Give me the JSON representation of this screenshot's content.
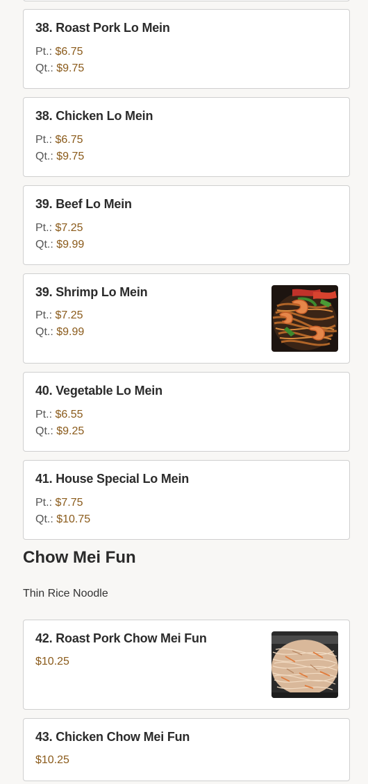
{
  "items": [
    {
      "name": "38. Roast Pork Lo Mein",
      "pt_label": "Pt.:",
      "pt_price": "$6.75",
      "qt_label": "Qt.:",
      "qt_price": "$9.75"
    },
    {
      "name": "38. Chicken Lo Mein",
      "pt_label": "Pt.:",
      "pt_price": "$6.75",
      "qt_label": "Qt.:",
      "qt_price": "$9.75"
    },
    {
      "name": "39. Beef Lo Mein",
      "pt_label": "Pt.:",
      "pt_price": "$7.25",
      "qt_label": "Qt.:",
      "qt_price": "$9.99"
    },
    {
      "name": "39. Shrimp Lo Mein",
      "pt_label": "Pt.:",
      "pt_price": "$7.25",
      "qt_label": "Qt.:",
      "qt_price": "$9.99"
    },
    {
      "name": "40. Vegetable Lo Mein",
      "pt_label": "Pt.:",
      "pt_price": "$6.55",
      "qt_label": "Qt.:",
      "qt_price": "$9.25"
    },
    {
      "name": "41. House Special Lo Mein",
      "pt_label": "Pt.:",
      "pt_price": "$7.75",
      "qt_label": "Qt.:",
      "qt_price": "$10.75"
    }
  ],
  "section": {
    "title": "Chow Mei Fun",
    "subtitle": "Thin Rice Noodle"
  },
  "fun_items": [
    {
      "name": "42. Roast Pork Chow Mei Fun",
      "price": "$10.25"
    },
    {
      "name": "43. Chicken Chow Mei Fun",
      "price": "$10.25"
    }
  ],
  "colors": {
    "price": "#8a5a1a",
    "card_border": "#cfcfcf",
    "background": "#f8f7f5"
  }
}
